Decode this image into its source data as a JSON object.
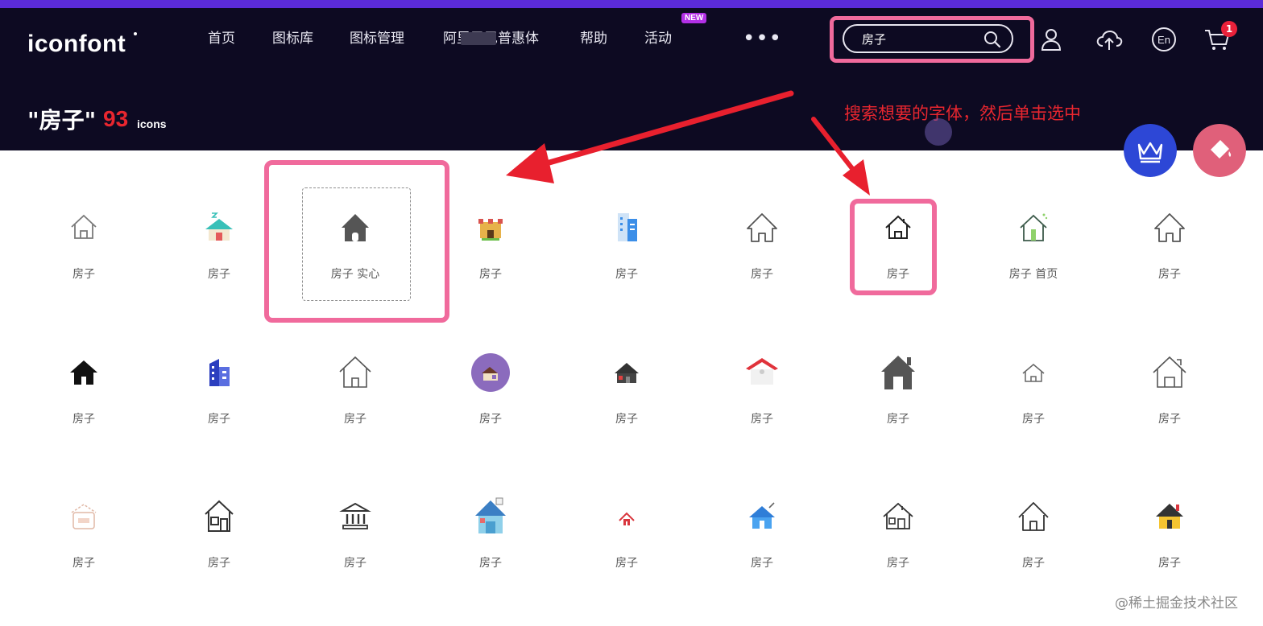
{
  "header": {
    "logo": "iconfont",
    "nav": [
      {
        "label": "首页"
      },
      {
        "label": "图标库"
      },
      {
        "label": "图标管理"
      },
      {
        "label": "阿里巴巴普惠体"
      },
      {
        "label": "帮助"
      },
      {
        "label": "活动"
      }
    ],
    "nav_badge": "NEW",
    "nav_more": "•••",
    "search_value": "房子",
    "cart_count": "1",
    "icons": [
      "search-icon",
      "user-icon",
      "upload-cloud-icon",
      "language-en-icon",
      "cart-icon"
    ]
  },
  "result": {
    "title": "\"房子\"",
    "count": "93",
    "unit": "icons"
  },
  "annotation": "搜索想要的字体，然后单击选中",
  "colors": {
    "header_bg": "#0d0a22",
    "accent_purple": "#5b2bd8",
    "highlight_pink": "#f06a9c",
    "annotation_red": "#e8262f",
    "fab_blue": "#2d47d6",
    "fab_pink": "#e0607a"
  },
  "grid": {
    "rows": [
      [
        {
          "label": "房子",
          "icon": "house-outline-icon"
        },
        {
          "label": "房子",
          "icon": "house-colored-teal-icon"
        },
        {
          "label": "房子 实心",
          "icon": "house-solid-icon"
        },
        {
          "label": "房子",
          "icon": "castle-colored-icon"
        },
        {
          "label": "房子",
          "icon": "building-blue-icon"
        },
        {
          "label": "房子",
          "icon": "house-line-icon"
        },
        {
          "label": "房子",
          "icon": "house-chimney-line-icon"
        },
        {
          "label": "房子 首页",
          "icon": "house-green-home-icon"
        },
        {
          "label": "房子",
          "icon": "house-line-icon"
        }
      ],
      [
        {
          "label": "房子",
          "icon": "house-black-solid-icon"
        },
        {
          "label": "房子",
          "icon": "building-indigo-icon"
        },
        {
          "label": "房子",
          "icon": "house-roof-outline-icon"
        },
        {
          "label": "房子",
          "icon": "house-circle-purple-icon"
        },
        {
          "label": "房子",
          "icon": "house-dark-small-icon"
        },
        {
          "label": "房子",
          "icon": "house-red-roof-icon"
        },
        {
          "label": "房子",
          "icon": "house-gray-chimney-icon"
        },
        {
          "label": "房子",
          "icon": "house-thin-line-icon"
        },
        {
          "label": "房子",
          "icon": "house-chimney-outline-icon"
        }
      ],
      [
        {
          "label": "房子",
          "icon": "house-beige-outline-icon"
        },
        {
          "label": "房子",
          "icon": "house-window-outline-icon"
        },
        {
          "label": "房子",
          "icon": "bank-outline-icon"
        },
        {
          "label": "房子",
          "icon": "house-blue-tall-icon"
        },
        {
          "label": "房子",
          "icon": "house-red-small-icon"
        },
        {
          "label": "房子",
          "icon": "house-blue-icon"
        },
        {
          "label": "房子",
          "icon": "house-cottage-outline-icon"
        },
        {
          "label": "房子",
          "icon": "house-line-icon"
        },
        {
          "label": "房子",
          "icon": "house-yellow-icon"
        }
      ]
    ]
  },
  "watermark": "@稀土掘金技术社区"
}
